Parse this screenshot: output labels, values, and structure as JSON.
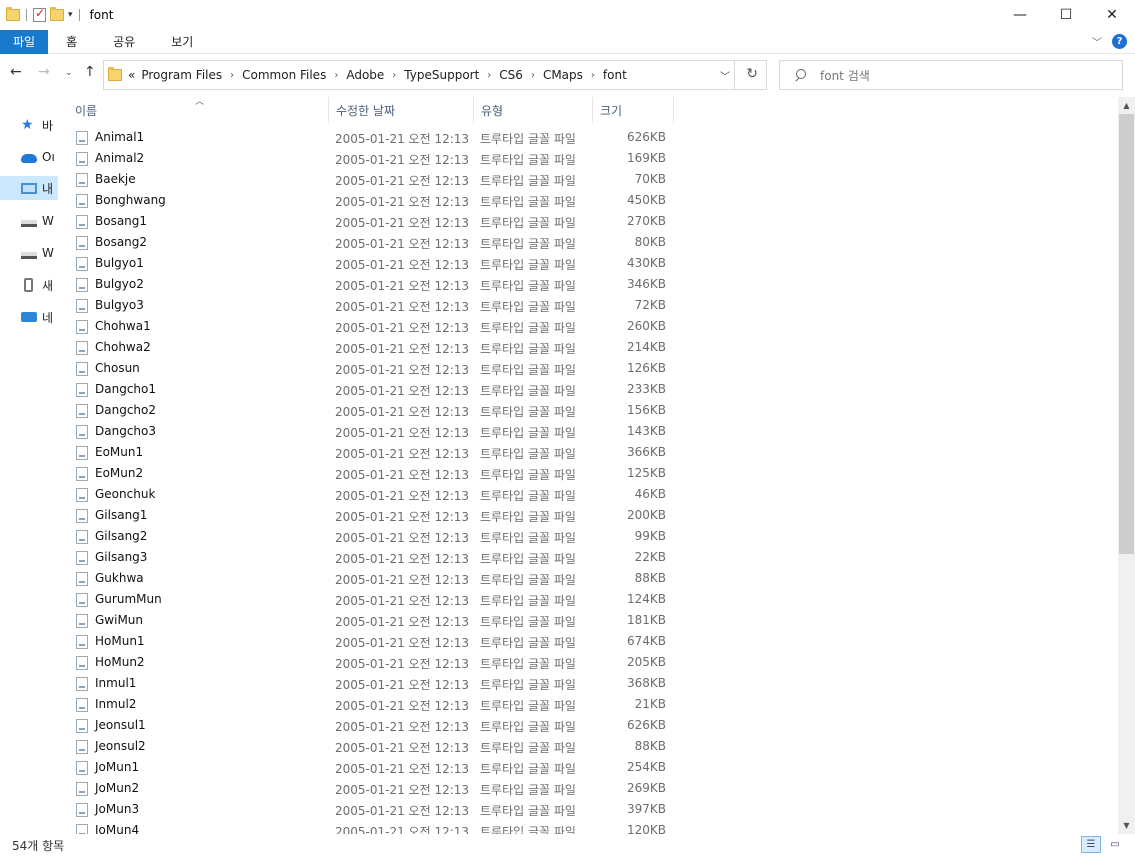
{
  "window": {
    "title": "font",
    "minimize": "—",
    "maximize": "☐",
    "close": "✕"
  },
  "ribbon": {
    "tabs": [
      "파일",
      "홈",
      "공유",
      "보기"
    ],
    "help": "?"
  },
  "nav": {
    "back": "←",
    "forward": "→",
    "recent": "⌄",
    "up": "↑",
    "overflow": "«",
    "breadcrumb": [
      "Program Files",
      "Common Files",
      "Adobe",
      "TypeSupport",
      "CS6",
      "CMaps",
      "font"
    ],
    "refresh": "↻"
  },
  "search": {
    "placeholder": "font 검색"
  },
  "sidebar": {
    "items": [
      {
        "label": "바",
        "icon": "star-icon"
      },
      {
        "label": "Oı",
        "icon": "cloud-icon"
      },
      {
        "label": "내",
        "icon": "pc-icon"
      },
      {
        "label": "W",
        "icon": "drive-icon"
      },
      {
        "label": "W",
        "icon": "drive-icon"
      },
      {
        "label": "새",
        "icon": "phone-icon"
      },
      {
        "label": "네",
        "icon": "network-icon"
      }
    ]
  },
  "columns": {
    "name": "이름",
    "date": "수정한 날짜",
    "type": "유형",
    "size": "크기"
  },
  "files": [
    {
      "name": "Animal1",
      "date": "2005-01-21 오전 12:13",
      "type": "트루타입 글꼴 파일",
      "size": "626KB"
    },
    {
      "name": "Animal2",
      "date": "2005-01-21 오전 12:13",
      "type": "트루타입 글꼴 파일",
      "size": "169KB"
    },
    {
      "name": "Baekje",
      "date": "2005-01-21 오전 12:13",
      "type": "트루타입 글꼴 파일",
      "size": "70KB"
    },
    {
      "name": "Bonghwang",
      "date": "2005-01-21 오전 12:13",
      "type": "트루타입 글꼴 파일",
      "size": "450KB"
    },
    {
      "name": "Bosang1",
      "date": "2005-01-21 오전 12:13",
      "type": "트루타입 글꼴 파일",
      "size": "270KB"
    },
    {
      "name": "Bosang2",
      "date": "2005-01-21 오전 12:13",
      "type": "트루타입 글꼴 파일",
      "size": "80KB"
    },
    {
      "name": "Bulgyo1",
      "date": "2005-01-21 오전 12:13",
      "type": "트루타입 글꼴 파일",
      "size": "430KB"
    },
    {
      "name": "Bulgyo2",
      "date": "2005-01-21 오전 12:13",
      "type": "트루타입 글꼴 파일",
      "size": "346KB"
    },
    {
      "name": "Bulgyo3",
      "date": "2005-01-21 오전 12:13",
      "type": "트루타입 글꼴 파일",
      "size": "72KB"
    },
    {
      "name": "Chohwa1",
      "date": "2005-01-21 오전 12:13",
      "type": "트루타입 글꼴 파일",
      "size": "260KB"
    },
    {
      "name": "Chohwa2",
      "date": "2005-01-21 오전 12:13",
      "type": "트루타입 글꼴 파일",
      "size": "214KB"
    },
    {
      "name": "Chosun",
      "date": "2005-01-21 오전 12:13",
      "type": "트루타입 글꼴 파일",
      "size": "126KB"
    },
    {
      "name": "Dangcho1",
      "date": "2005-01-21 오전 12:13",
      "type": "트루타입 글꼴 파일",
      "size": "233KB"
    },
    {
      "name": "Dangcho2",
      "date": "2005-01-21 오전 12:13",
      "type": "트루타입 글꼴 파일",
      "size": "156KB"
    },
    {
      "name": "Dangcho3",
      "date": "2005-01-21 오전 12:13",
      "type": "트루타입 글꼴 파일",
      "size": "143KB"
    },
    {
      "name": "EoMun1",
      "date": "2005-01-21 오전 12:13",
      "type": "트루타입 글꼴 파일",
      "size": "366KB"
    },
    {
      "name": "EoMun2",
      "date": "2005-01-21 오전 12:13",
      "type": "트루타입 글꼴 파일",
      "size": "125KB"
    },
    {
      "name": "Geonchuk",
      "date": "2005-01-21 오전 12:13",
      "type": "트루타입 글꼴 파일",
      "size": "46KB"
    },
    {
      "name": "Gilsang1",
      "date": "2005-01-21 오전 12:13",
      "type": "트루타입 글꼴 파일",
      "size": "200KB"
    },
    {
      "name": "Gilsang2",
      "date": "2005-01-21 오전 12:13",
      "type": "트루타입 글꼴 파일",
      "size": "99KB"
    },
    {
      "name": "Gilsang3",
      "date": "2005-01-21 오전 12:13",
      "type": "트루타입 글꼴 파일",
      "size": "22KB"
    },
    {
      "name": "Gukhwa",
      "date": "2005-01-21 오전 12:13",
      "type": "트루타입 글꼴 파일",
      "size": "88KB"
    },
    {
      "name": "GurumMun",
      "date": "2005-01-21 오전 12:13",
      "type": "트루타입 글꼴 파일",
      "size": "124KB"
    },
    {
      "name": "GwiMun",
      "date": "2005-01-21 오전 12:13",
      "type": "트루타입 글꼴 파일",
      "size": "181KB"
    },
    {
      "name": "HoMun1",
      "date": "2005-01-21 오전 12:13",
      "type": "트루타입 글꼴 파일",
      "size": "674KB"
    },
    {
      "name": "HoMun2",
      "date": "2005-01-21 오전 12:13",
      "type": "트루타입 글꼴 파일",
      "size": "205KB"
    },
    {
      "name": "Inmul1",
      "date": "2005-01-21 오전 12:13",
      "type": "트루타입 글꼴 파일",
      "size": "368KB"
    },
    {
      "name": "Inmul2",
      "date": "2005-01-21 오전 12:13",
      "type": "트루타입 글꼴 파일",
      "size": "21KB"
    },
    {
      "name": "Jeonsul1",
      "date": "2005-01-21 오전 12:13",
      "type": "트루타입 글꼴 파일",
      "size": "626KB"
    },
    {
      "name": "Jeonsul2",
      "date": "2005-01-21 오전 12:13",
      "type": "트루타입 글꼴 파일",
      "size": "88KB"
    },
    {
      "name": "JoMun1",
      "date": "2005-01-21 오전 12:13",
      "type": "트루타입 글꼴 파일",
      "size": "254KB"
    },
    {
      "name": "JoMun2",
      "date": "2005-01-21 오전 12:13",
      "type": "트루타입 글꼴 파일",
      "size": "269KB"
    },
    {
      "name": "JoMun3",
      "date": "2005-01-21 오전 12:13",
      "type": "트루타입 글꼴 파일",
      "size": "397KB"
    },
    {
      "name": "JoMun4",
      "date": "2005-01-21 오전 12:13",
      "type": "트루타입 글꼴 파일",
      "size": "120KB"
    }
  ],
  "status": {
    "item_count": "54개 항목"
  },
  "colors": {
    "file_tab": "#1979ca",
    "selected_nav": "#cce8ff",
    "header_text": "#4c607a"
  }
}
